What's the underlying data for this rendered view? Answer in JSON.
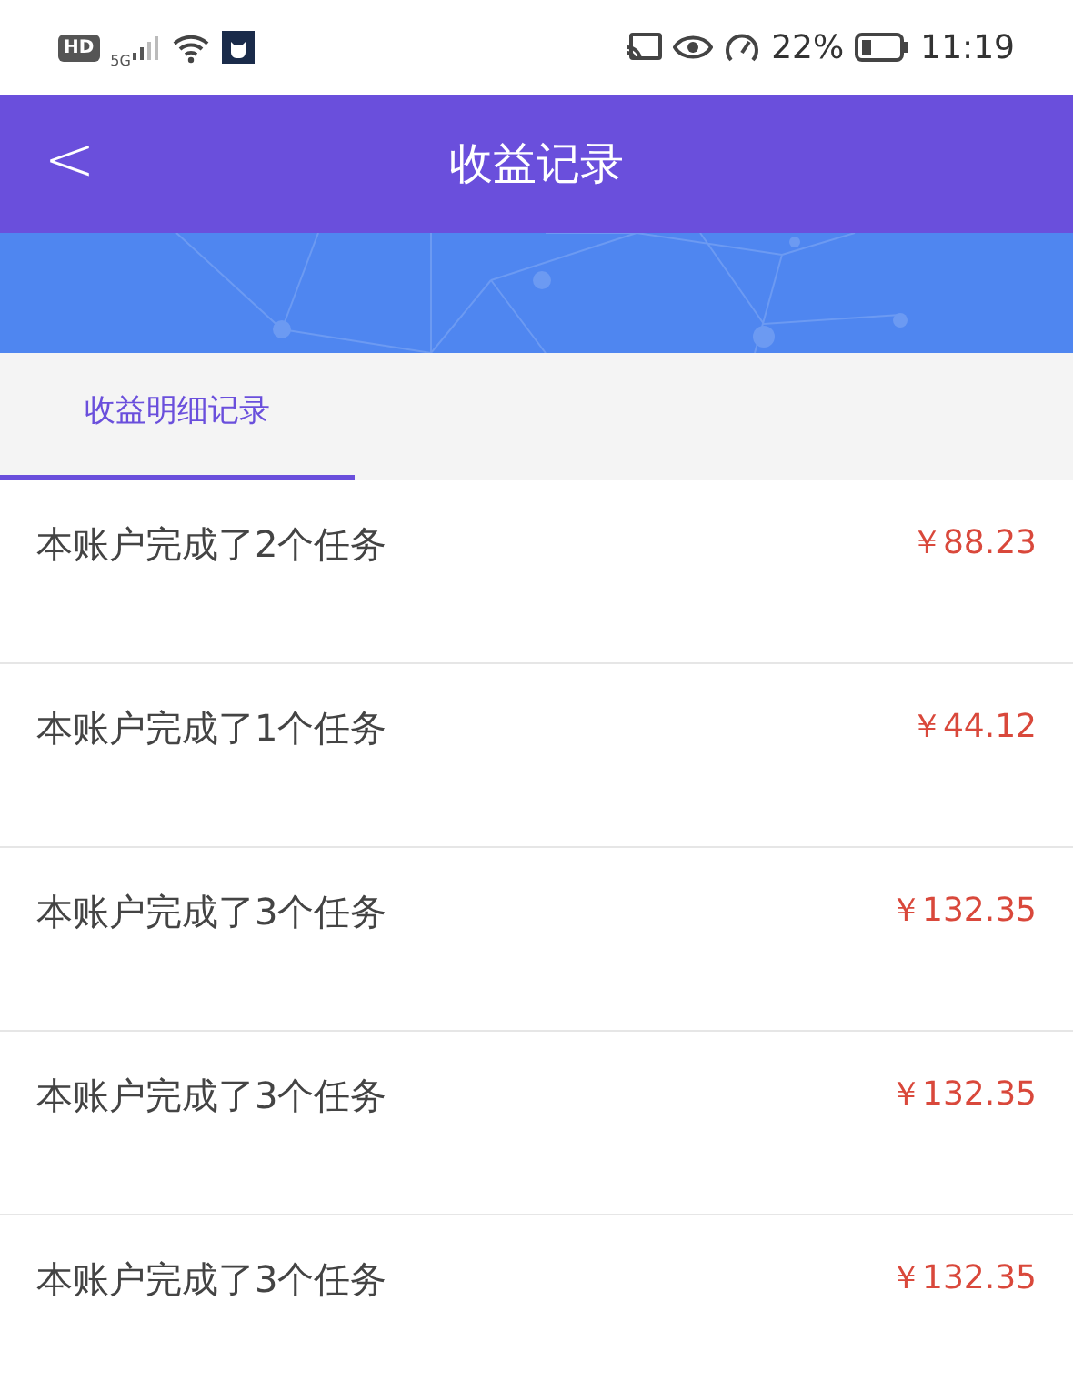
{
  "status_bar": {
    "hd": "HD",
    "network": "5G",
    "battery": "22%",
    "time": "11:19"
  },
  "header": {
    "back": "<",
    "title": "收益记录"
  },
  "tabs": [
    {
      "label": "收益明细记录",
      "selected": true
    }
  ],
  "records": [
    {
      "text": "本账户完成了2个任务",
      "amount": "￥88.23"
    },
    {
      "text": "本账户完成了1个任务",
      "amount": "￥44.12"
    },
    {
      "text": "本账户完成了3个任务",
      "amount": "￥132.35"
    },
    {
      "text": "本账户完成了3个任务",
      "amount": "￥132.35"
    },
    {
      "text": "本账户完成了3个任务",
      "amount": "￥132.35"
    }
  ]
}
